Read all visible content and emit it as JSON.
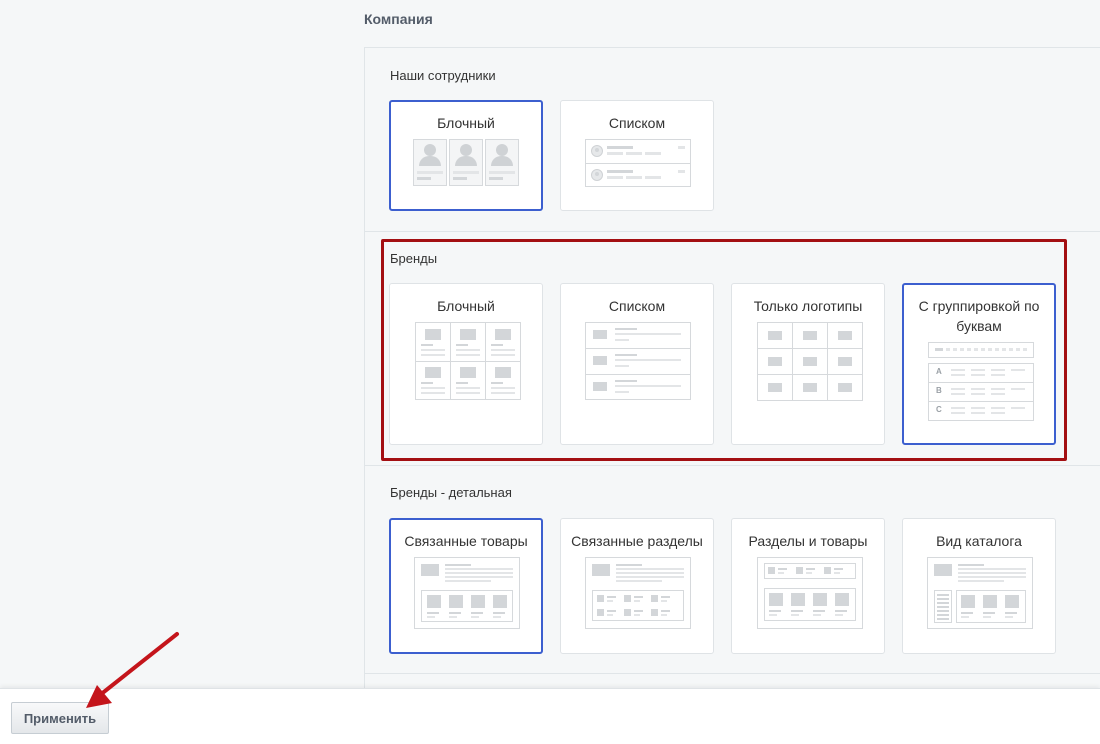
{
  "page": {
    "title": "Компания"
  },
  "employees": {
    "title": "Наши сотрудники",
    "options": [
      "Блочный",
      "Списком"
    ]
  },
  "brands": {
    "title": "Бренды",
    "options": [
      "Блочный",
      "Списком",
      "Только логотипы",
      "С группировкой по буквам"
    ],
    "letters": [
      "A",
      "B",
      "C"
    ]
  },
  "brand_detail": {
    "title": "Бренды - детальная",
    "options": [
      "Связанные товары",
      "Связанные разделы",
      "Разделы и товары",
      "Вид каталога"
    ]
  },
  "footer": {
    "apply_label": "Применить"
  },
  "colors": {
    "selected_border": "#3c5fcf",
    "highlight_border": "#a30f12",
    "arrow": "#c4151b"
  }
}
